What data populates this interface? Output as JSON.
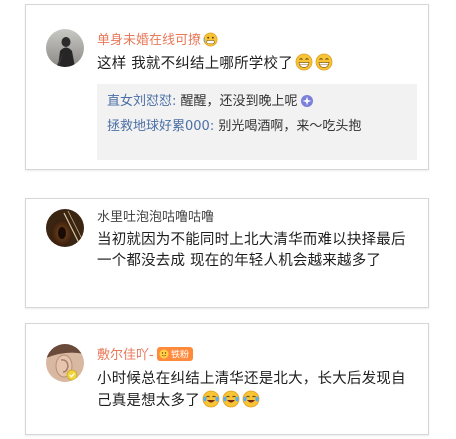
{
  "comments": [
    {
      "username": "单身未婚在线可撩",
      "avatar_icon": "person-silhouette-avatar",
      "text": "这样 我就不纠结上哪所学校了",
      "emojis": [
        "grin-emoji",
        "grin-emoji"
      ],
      "replies": [
        {
          "user": "直女刘怼怼:",
          "text": " 醒醒，还没到晚上呢",
          "emoji": "sparkle-emoji"
        },
        {
          "user": "拯救地球好累000:",
          "text": " 别光喝酒啊，来～吃头抱",
          "emoji": ""
        }
      ]
    },
    {
      "username": "水里吐泡泡咕噜咕噜",
      "avatar_icon": "violin-avatar",
      "text": "当初就因为不能同时上北大清华而难以抉择最后一个都没去成 现在的年轻人机会越来越多了",
      "emojis": []
    },
    {
      "username": "敷尔佳吖-",
      "avatar_icon": "ear-closeup-avatar",
      "badge": "铁粉",
      "text": "小时候总在纠结上清华还是北大，长大后发现自己真是想太多了",
      "emojis": [
        "laugh-cry-emoji",
        "laugh-cry-emoji",
        "laugh-cry-emoji"
      ]
    }
  ],
  "colors": {
    "username_accent": "#e8795a",
    "reply_user": "#4b6fa5",
    "reply_bg": "#f2f2f2"
  }
}
